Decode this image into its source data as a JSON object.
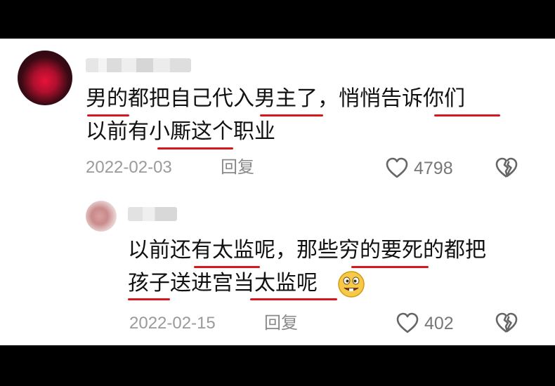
{
  "comments": [
    {
      "text_line1": "男的都把自己代入男主了，悄悄告诉你们",
      "text_line2": "以前有小厮这个职业",
      "date": "2022-02-03",
      "reply_label": "回复",
      "likes": "4798",
      "like_icon": "heart-outline-icon",
      "dislike_icon": "broken-heart-icon"
    },
    {
      "text_line1": "以前还有太监呢，那些穷的要死的都把",
      "text_line2": "孩子送进宫当太监呢",
      "emoji": "😋",
      "date": "2022-02-15",
      "reply_label": "回复",
      "likes": "402",
      "like_icon": "heart-outline-icon",
      "dislike_icon": "broken-heart-icon"
    }
  ],
  "colors": {
    "underline": "#d8161d",
    "meta": "#9a9a9a",
    "background": "#ffffff",
    "frame": "#000000"
  }
}
